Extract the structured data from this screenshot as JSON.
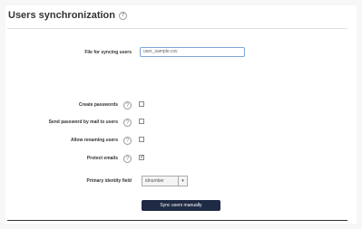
{
  "header": {
    "title": "Users synchronization"
  },
  "fields": {
    "file_label": "File for syncing users",
    "file_value": "user_sample.csv",
    "create_passwords_label": "Create passwords",
    "send_password_label": "Send password by mail to users",
    "allow_renaming_label": "Allow renaming users",
    "protect_emails_label": "Protect emails",
    "primary_identity_label": "Primary identity field",
    "primary_identity_value": "idnumber",
    "checkbox_checked_glyph": "✓"
  },
  "actions": {
    "sync_label": "Sync users manually"
  },
  "states": {
    "create_passwords": false,
    "send_password": false,
    "allow_renaming": false,
    "protect_emails": true
  },
  "colors": {
    "button_bg": "#1f2a44",
    "input_border": "#7aa7d6"
  }
}
